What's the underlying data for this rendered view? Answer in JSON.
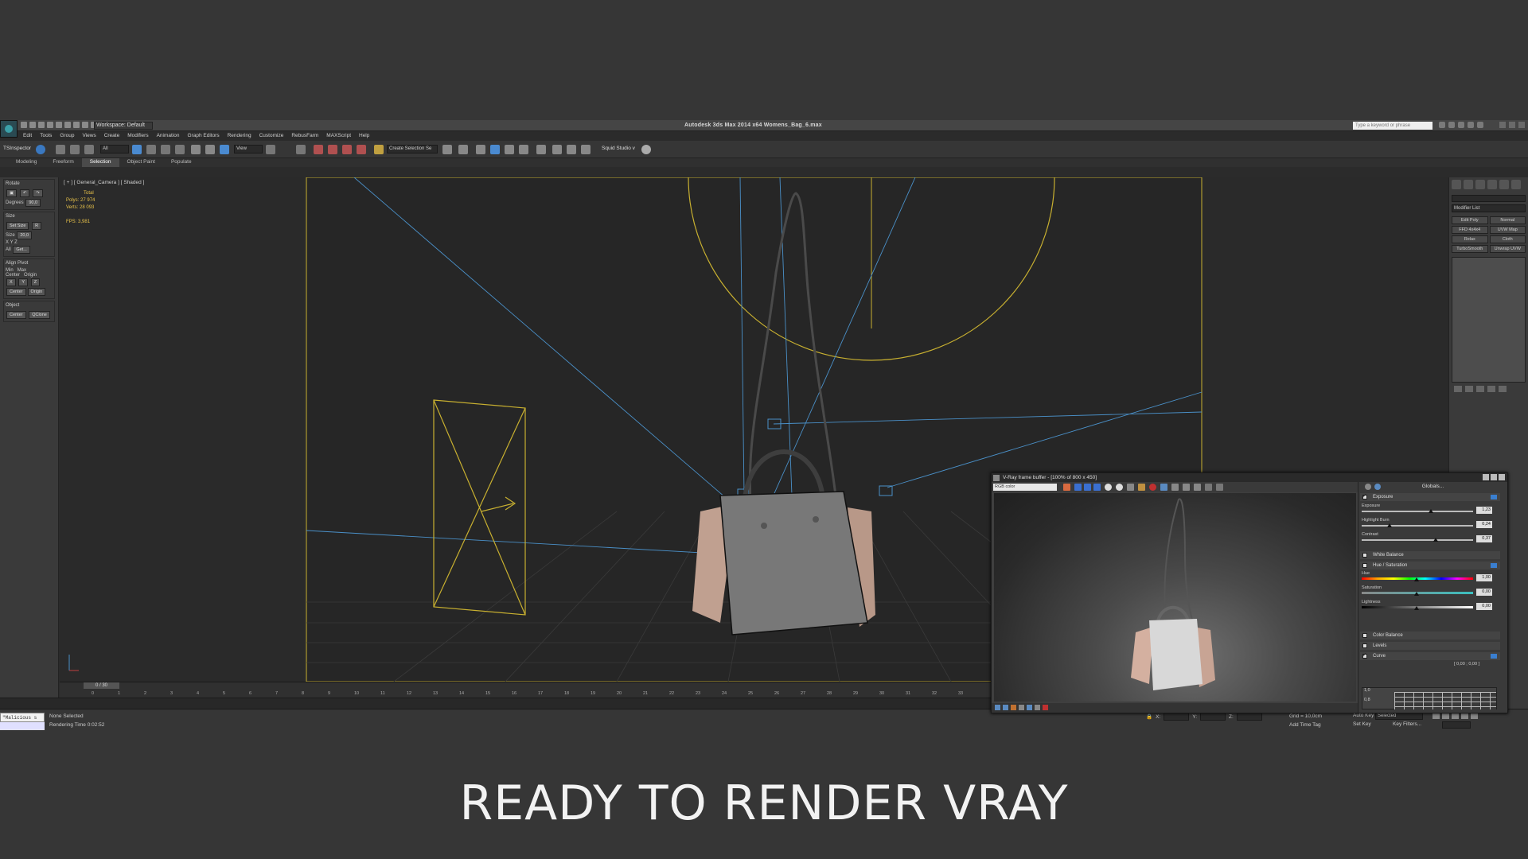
{
  "app": {
    "title": "Autodesk 3ds Max  2014 x64    Womens_Bag_6.max",
    "workspace": "Workspace: Default",
    "search_placeholder": "Type a keyword or phrase"
  },
  "menu": [
    "Edit",
    "Tools",
    "Group",
    "Views",
    "Create",
    "Modifiers",
    "Animation",
    "Graph Editors",
    "Rendering",
    "Customize",
    "RebusFarm",
    "MAXScript",
    "Help"
  ],
  "toolbar": {
    "tsinspector": "TSInspector",
    "filter": "All",
    "view": "View",
    "selection_set": "Create Selection Se",
    "squid": "Squid Studio v"
  },
  "ribbon": {
    "tabs": [
      "Modeling",
      "Freeform",
      "Selection",
      "Object Paint",
      "Populate"
    ],
    "active": 2
  },
  "left_panel": {
    "rotate": "Rotate",
    "degrees_label": "Degrees",
    "degrees_value": "90,0",
    "size": "Size",
    "set_size": "Set Size",
    "r": "R",
    "size_label": "Size",
    "size_value": "20,0",
    "x": "X",
    "y": "Y",
    "z": "Z",
    "all": "All",
    "get": "Get...",
    "align_pivot": "Align Pivot",
    "min": "Min",
    "max": "Max",
    "center": "Center",
    "origin": "Origin",
    "center_btn": "Center",
    "origin_btn": "Origin",
    "object": "Object",
    "obj_center": "Center",
    "qclone": "QClone"
  },
  "viewport": {
    "label": "[ + ] [ General_Camera ] [ Shaded ]",
    "stats_total": "Total",
    "polys_label": "Polys:",
    "polys_value": "27 974",
    "verts_label": "Verts:",
    "verts_value": "28 093",
    "fps_label": "FPS:",
    "fps_value": "3,981"
  },
  "right_panel": {
    "modifier_list": "Modifier List",
    "mods": [
      "Edit Poly",
      "Normal",
      "FFD 4x4x4",
      "UVW Map",
      "Relax",
      "Cloth",
      "TurboSmooth",
      "Unwrap UVW"
    ]
  },
  "timeline": {
    "frame": "0 / 30",
    "ticks": [
      "0",
      "1",
      "2",
      "3",
      "4",
      "5",
      "6",
      "7",
      "8",
      "9",
      "10",
      "11",
      "12",
      "13",
      "14",
      "15",
      "16",
      "17",
      "18",
      "19",
      "20",
      "21",
      "22",
      "23",
      "24",
      "25",
      "26",
      "27",
      "28",
      "29",
      "30",
      "31",
      "32",
      "33"
    ]
  },
  "status": {
    "maxscript": "\"Malicious s",
    "selection": "None Selected",
    "render_time": "Rendering Time  0:02:52",
    "x": "X:",
    "y": "Y:",
    "z": "Z:",
    "grid": "Grid = 10,0cm",
    "add_time_tag": "Add Time Tag",
    "auto_key": "Auto Key",
    "selected": "Selected",
    "set_key": "Set Key",
    "key_filters": "Key Filters..."
  },
  "vfb": {
    "title": "V-Ray frame buffer - [100% of 800 x 450]",
    "channel": "RGB color",
    "globals": "Globals...",
    "exposure": "Exposure",
    "exposure_label": "Exposure",
    "exposure_value": "1,23",
    "highlight_label": "Highlight Burn",
    "highlight_value": "0,24",
    "contrast_label": "Contrast",
    "contrast_value": "0,37",
    "white_balance": "White Balance",
    "hue_sat": "Hue / Saturation",
    "hue_label": "Hue",
    "hue_value": "1,00",
    "sat_label": "Saturation",
    "sat_value": "0,00",
    "light_label": "Lightness",
    "light_value": "0,00",
    "color_balance": "Color Balance",
    "levels": "Levels",
    "curve": "Curve",
    "curve_coords": "[ 0,00 ; 0,00 ]",
    "curve_y1": "1,0",
    "curve_y2": "0,8"
  },
  "colors": {
    "accent": "#e8c24a",
    "camera_lines": "#4a90c8",
    "light": "#d8c030",
    "bag_body": "#7a7a7a",
    "bag_side": "#c8a898"
  },
  "caption": "READY TO RENDER VRAY"
}
